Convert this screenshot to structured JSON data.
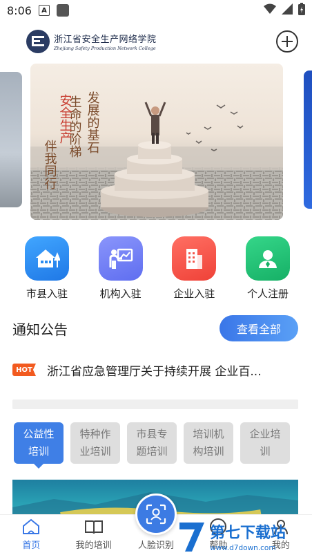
{
  "status_bar": {
    "time": "8:06"
  },
  "header": {
    "logo_cn": "浙江省安全生产网络学院",
    "logo_en": "Zhejiang Safety Production Network College"
  },
  "banner": {
    "line1": "发展的基石",
    "line2": "生命的阶梯",
    "line3": "安全生产",
    "line4": "伴我同行"
  },
  "quick_actions": [
    {
      "label": "市县入驻",
      "color": "#2a8cf0",
      "icon": "house-icon"
    },
    {
      "label": "机构入驻",
      "color": "#6e7cf6",
      "icon": "presentation-icon"
    },
    {
      "label": "企业入驻",
      "color": "#f4564c",
      "icon": "building-icon"
    },
    {
      "label": "个人注册",
      "color": "#1fbf74",
      "icon": "person-icon"
    }
  ],
  "notice": {
    "title": "通知公告",
    "view_all": "查看全部",
    "hot_badge": "HOT",
    "item_text": "浙江省应急管理厅关于持续开展 企业百..."
  },
  "training_tabs": [
    {
      "label": "公益性\n培训",
      "active": true
    },
    {
      "label": "特种作\n业培训",
      "active": false
    },
    {
      "label": "市县专\n题培训",
      "active": false
    },
    {
      "label": "培训机\n构培训",
      "active": false
    },
    {
      "label": "企业培\n训",
      "active": false
    }
  ],
  "tabbar": {
    "home": "首页",
    "my_training": "我的培训",
    "face": "人脸识别",
    "help": "帮助",
    "mine": "我的"
  },
  "watermark": {
    "brand": "第七下载站",
    "url": "www.d7down.com"
  }
}
